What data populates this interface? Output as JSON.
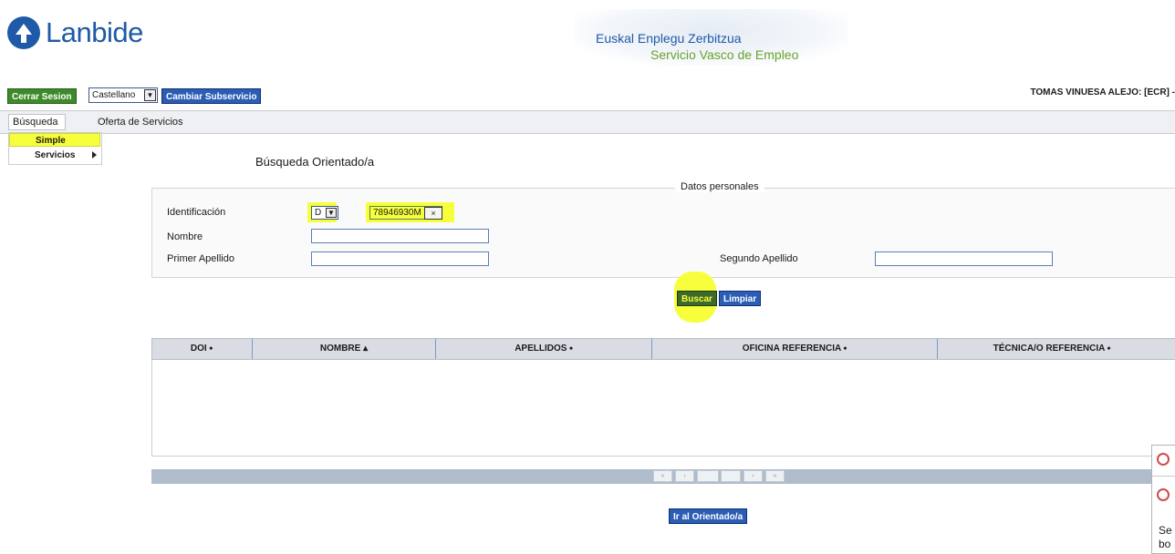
{
  "header": {
    "logo_text": "Lanbide",
    "brand_line1": "Euskal Enplegu Zerbitzua",
    "brand_line2": "Servicio Vasco de Empleo"
  },
  "toolbar": {
    "logout_label": "Cerrar Sesion",
    "language_value": "Castellano",
    "change_service_label": "Cambiar Subservicio",
    "user_label": "TOMAS VINUESA ALEJO: [ECR] -"
  },
  "menu": {
    "items": [
      {
        "label": "Búsqueda"
      },
      {
        "label": "Oferta de Servicios"
      }
    ],
    "dropdown": [
      {
        "label": "Simple"
      },
      {
        "label": "Servicios"
      }
    ]
  },
  "form": {
    "title": "Búsqueda Orientado/a",
    "legend": "Datos personales",
    "id_label": "Identificación",
    "id_type_value": "D",
    "id_number_value": "78946930M",
    "clear_symbol": "×",
    "nombre_label": "Nombre",
    "nombre_value": "",
    "apellido1_label": "Primer Apellido",
    "apellido1_value": "",
    "apellido2_label": "Segundo Apellido",
    "apellido2_value": "",
    "buscar_label": "Buscar",
    "limpiar_label": "Limpiar"
  },
  "table": {
    "columns": [
      {
        "label": "DOI ⬩"
      },
      {
        "label": "NOMBRE ▴"
      },
      {
        "label": "APELLIDOS ⬩"
      },
      {
        "label": "OFICINA REFERENCIA ⬩"
      },
      {
        "label": "TÉCNICA/O REFERENCIA ⬩"
      }
    ],
    "rows": []
  },
  "pager": {
    "first": "«",
    "prev": "‹",
    "page": "",
    "next": "›",
    "last": "»"
  },
  "actions": {
    "go_label": "Ir al Orientado/a"
  },
  "side_panel": {
    "text_line1": "Se",
    "text_line2": "bo"
  },
  "colors": {
    "brand_blue": "#1e5aa8",
    "brand_green": "#6aa32a",
    "highlight": "#f7ff3c",
    "button_blue": "#2b5db5"
  }
}
